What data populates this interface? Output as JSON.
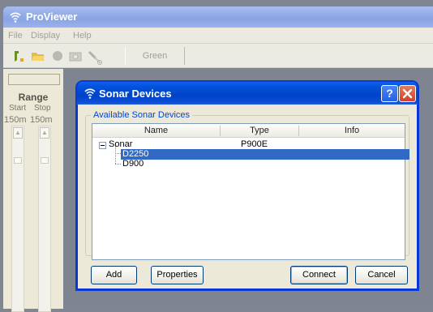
{
  "app": {
    "title": "ProViewer"
  },
  "menu": {
    "items": [
      "File",
      "Display",
      "Help"
    ]
  },
  "toolbar": {
    "green_label": "Green"
  },
  "left_panel": {
    "title": "Range",
    "start_label": "Start",
    "stop_label": "Stop",
    "start_value": "150m",
    "stop_value": "150m"
  },
  "dialog": {
    "title": "Sonar Devices",
    "group_label": "Available Sonar Devices",
    "columns": [
      "Name",
      "Type",
      "Info"
    ],
    "rows": [
      {
        "name": "Sonar",
        "type": "P900E",
        "info": ""
      },
      {
        "name": "D2250",
        "type": "",
        "info": ""
      },
      {
        "name": "D900",
        "type": "",
        "info": ""
      }
    ],
    "buttons": {
      "add": "Add",
      "properties": "Properties",
      "connect": "Connect",
      "cancel": "Cancel"
    },
    "help_glyph": "?",
    "close_glyph": "✕"
  },
  "colors": {
    "dialog_titlebar": "#0043c8",
    "selection": "#316ac5",
    "group_label": "#0046d5"
  }
}
